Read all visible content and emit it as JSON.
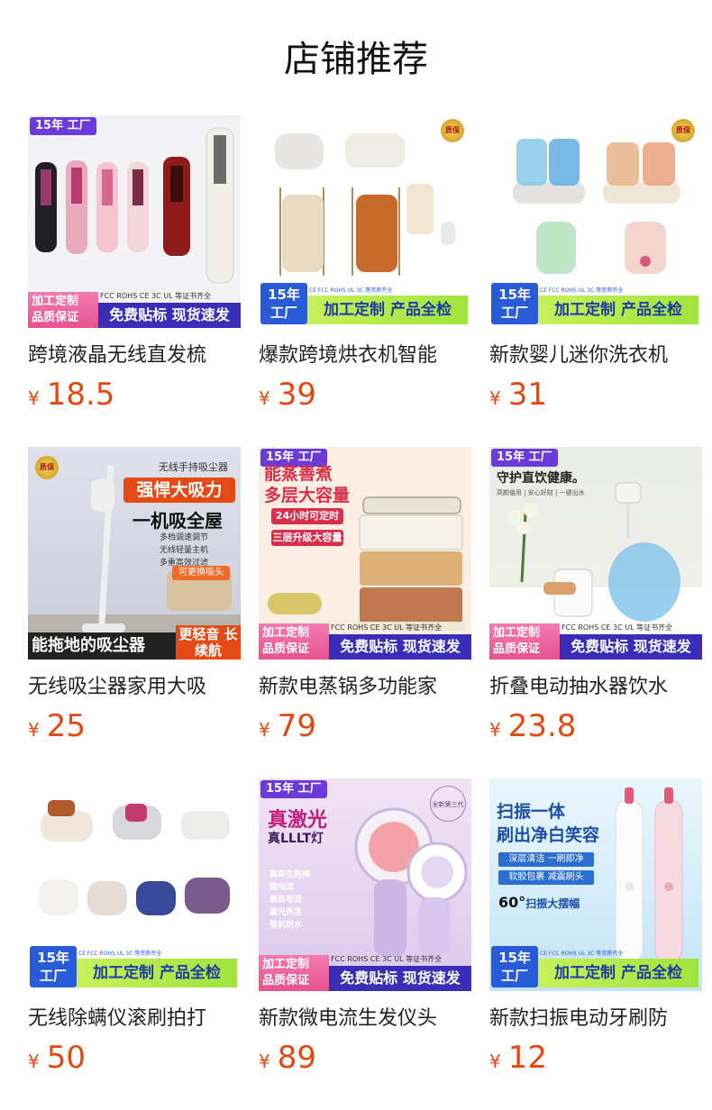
{
  "page_title": "店铺推荐",
  "currency": "¥",
  "products": [
    {
      "title": "跨境液晶无线直发梳",
      "price": "18.5",
      "badges": {
        "year": "15年 工厂",
        "left_a": "加工定制",
        "left_b": "品质保证",
        "right": "免费贴标 现货速发",
        "cert": "FCC ROHS CE 3C UL 等证书齐全"
      }
    },
    {
      "title": "爆款跨境烘衣机智能",
      "price": "39",
      "badges": {
        "seal": "质保",
        "year_a": "15年",
        "year_b": "工厂",
        "right": "加工定制 产品全检",
        "cert": "CE FCC ROHS UL 3C 等资质齐全"
      }
    },
    {
      "title": "新款婴儿迷你洗衣机",
      "price": "31",
      "badges": {
        "seal": "质保",
        "year_a": "15年",
        "year_b": "工厂",
        "right": "加工定制 产品全检",
        "cert": "CE FCC ROHS UL 3C 等资质齐全"
      }
    },
    {
      "title": "无线吸尘器家用大吸",
      "price": "25",
      "badges": {
        "seal": "质保",
        "top": "无线手持吸尘器",
        "h1": "强悍大吸力",
        "h2": "一机吸全屋",
        "f1": "多档调速调节",
        "f2": "无线轻量主机",
        "f3": "多重高效过滤",
        "tag": "可更换吸头",
        "bottom": "能拖地的吸尘器",
        "side": "更轻音 长续航"
      }
    },
    {
      "title": "新款电蒸锅多功能家",
      "price": "79",
      "badges": {
        "year": "15年 工厂",
        "h1": "能蒸善煮",
        "h2": "多层大容量",
        "r1": "24小时可定时",
        "r2": "三层升级大容量",
        "left_a": "加工定制",
        "left_b": "品质保证",
        "right": "免费贴标 现货速发",
        "cert": "FCC ROHS CE 3C UL 等证书齐全"
      }
    },
    {
      "title": "折叠电动抽水器饮水",
      "price": "23.8",
      "badges": {
        "year": "15年 工厂",
        "h1": "守护直饮健康。",
        "sub": "高颜值用 | 安心好财 | 一键出水",
        "left_a": "加工定制",
        "left_b": "品质保证",
        "right": "免费贴标 现货速发",
        "cert": "FCC ROHS CE 3C UL 等证书齐全"
      }
    },
    {
      "title": "无线除螨仪滚刷拍打",
      "price": "50",
      "badges": {
        "year_a": "15年",
        "year_b": "工厂",
        "right": "加工定制 产品全检",
        "cert": "CE FCC ROHS UL 3C 等资质齐全"
      }
    },
    {
      "title": "新款微电流生发仪头",
      "price": "89",
      "badges": {
        "year": "15年 工厂",
        "h1": "真激光",
        "h2": "真LLLT灯",
        "seal": "全新第三代",
        "f1": "真抑生防掉",
        "f2": "微电流",
        "f3": "滚珠导流",
        "f4": "激光养发",
        "f5": "整机防水",
        "left_a": "加工定制",
        "left_b": "品质保证",
        "right": "免费贴标 现货速发",
        "cert": "FCC ROHS CE 3C UL 等证书齐全"
      }
    },
    {
      "title": "新款扫振电动牙刷防",
      "price": "12",
      "badges": {
        "h1": "扫振一体",
        "h2": "刷出净白笑容",
        "r1": "深层清洁 一刷即净",
        "r2": "软胶包裹 减震刷头",
        "big": "60°",
        "big_txt": "扫振大摆幅",
        "year_a": "15年",
        "year_b": "工厂",
        "right": "加工定制 产品全检",
        "cert": "CE FCC ROHS UL 3C 等资质齐全"
      }
    }
  ]
}
